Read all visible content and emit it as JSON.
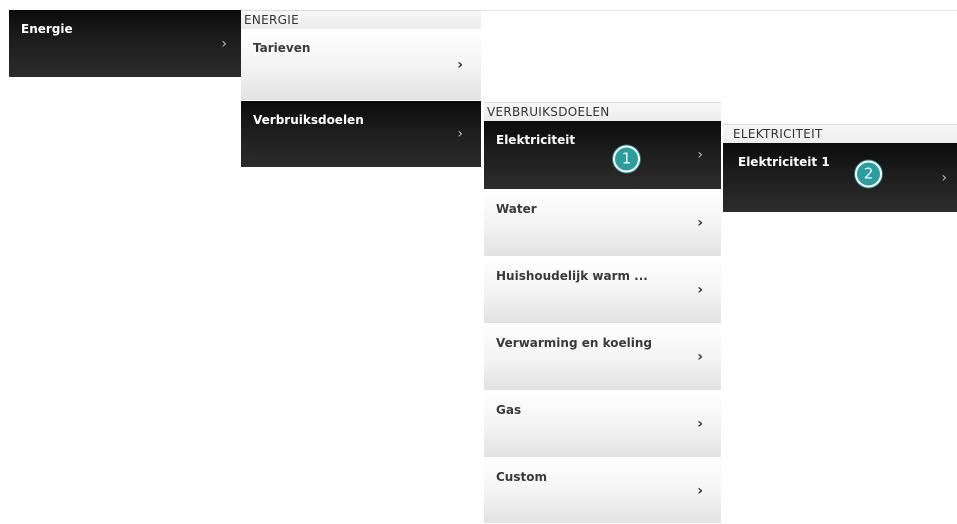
{
  "col1": {
    "items": [
      {
        "label": "Energie"
      }
    ]
  },
  "col2": {
    "header": "ENERGIE",
    "items": [
      {
        "label": "Tarieven"
      },
      {
        "label": "Verbruiksdoelen"
      }
    ]
  },
  "col3": {
    "header": "VERBRUIKSDOELEN",
    "items": [
      {
        "label": "Elektriciteit"
      },
      {
        "label": "Water"
      },
      {
        "label": "Huishoudelijk warm ..."
      },
      {
        "label": "Verwarming en koeling"
      },
      {
        "label": "Gas"
      },
      {
        "label": "Custom"
      }
    ]
  },
  "col4": {
    "header": "ELEKTRICITEIT",
    "items": [
      {
        "label": "Elektriciteit 1"
      }
    ]
  },
  "chevron": "›",
  "badges": {
    "one": "1",
    "two": "2"
  },
  "colors": {
    "badge": "#2a9d9f",
    "dark_item": "#1a1a1a"
  }
}
